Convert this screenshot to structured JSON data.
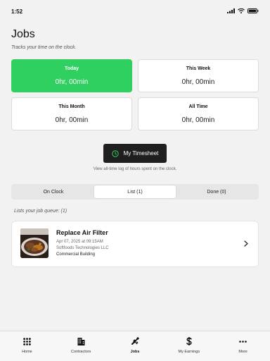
{
  "status_bar": {
    "time": "1:52"
  },
  "header": {
    "title": "Jobs",
    "subtitle": "Tracks your time on the clock."
  },
  "stats": [
    {
      "label": "Today",
      "value": "0hr, 00min",
      "active": true
    },
    {
      "label": "This Week",
      "value": "0hr, 00min",
      "active": false
    },
    {
      "label": "This Month",
      "value": "0hr, 00min",
      "active": false
    },
    {
      "label": "All Time",
      "value": "0hr, 00min",
      "active": false
    }
  ],
  "timesheet": {
    "button_label": "My Timesheet",
    "caption": "View all-time log of hours spent on the clock."
  },
  "segments": [
    {
      "label": "On Clock",
      "active": false
    },
    {
      "label": "List (1)",
      "active": true
    },
    {
      "label": "Done (0)",
      "active": false
    }
  ],
  "queue_label": "Lists your job queue: (1)",
  "jobs": [
    {
      "title": "Replace Air Filter",
      "date": "Apr 07, 2025 at 09:15AM",
      "company": "Softfoods Technologies LLC",
      "type": "Commercial Building"
    }
  ],
  "tab_bar": [
    {
      "label": "Home",
      "icon": "grid-icon",
      "active": false
    },
    {
      "label": "Contractors",
      "icon": "building-icon",
      "active": false
    },
    {
      "label": "Jobs",
      "icon": "tools-icon",
      "active": true
    },
    {
      "label": "My Earnings",
      "icon": "dollar-icon",
      "active": false
    },
    {
      "label": "More",
      "icon": "more-dots-icon",
      "active": false
    }
  ],
  "colors": {
    "accent": "#2fd060",
    "button_dark": "#1f1f1f",
    "background": "#f2f2f2"
  }
}
